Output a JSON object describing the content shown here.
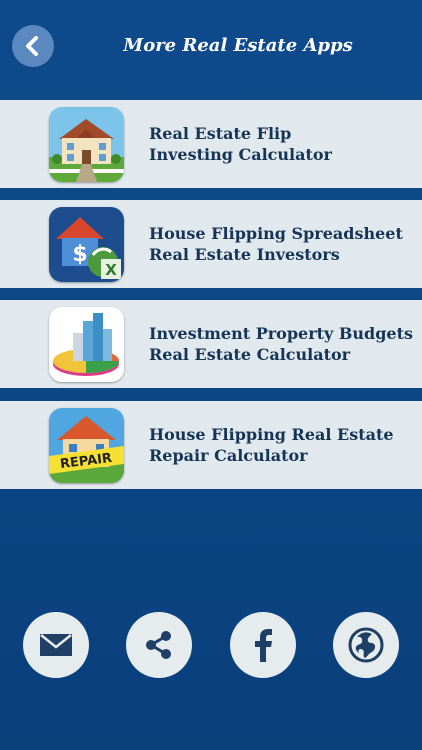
{
  "header": {
    "title": "More Real Estate Apps",
    "back_icon": "chevron-left-icon"
  },
  "apps": [
    {
      "line1": "Real Estate Flip",
      "line2": "Investing Calculator",
      "icon": "house-icon"
    },
    {
      "line1": "House Flipping Spreadsheet",
      "line2": "Real Estate Investors",
      "icon": "house-dollar-spreadsheet-icon"
    },
    {
      "line1": "Investment Property Budgets",
      "line2": "Real Estate Calculator",
      "icon": "buildings-pie-chart-icon"
    },
    {
      "line1": "House Flipping Real Estate",
      "line2": "Repair Calculator",
      "icon": "house-repair-icon",
      "badge": "REPAIR"
    }
  ],
  "share_buttons": [
    {
      "icon": "envelope-icon"
    },
    {
      "icon": "share-icon"
    },
    {
      "icon": "facebook-icon"
    },
    {
      "icon": "globe-icon"
    }
  ],
  "colors": {
    "background": "#0e4a8c",
    "row_background": "#e1e9ee",
    "row_text": "#163455",
    "title_text": "#ffffff",
    "button_background": "#e6ebee",
    "icon_color": "#1f3f66"
  }
}
